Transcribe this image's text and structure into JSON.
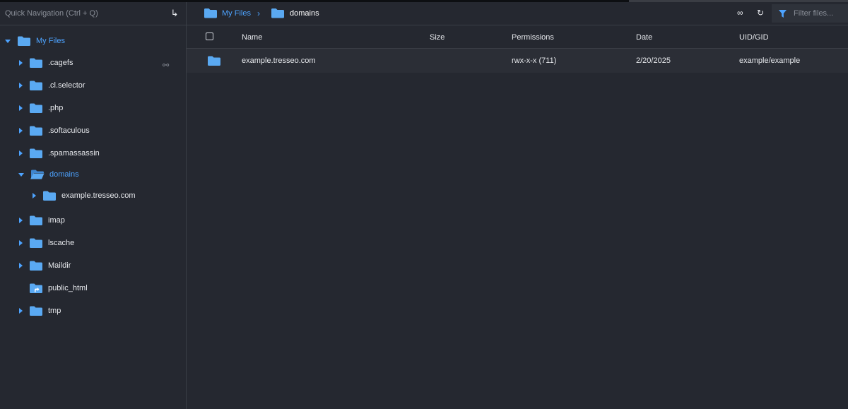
{
  "quicknav": {
    "placeholder": "Quick Navigation (Ctrl + Q)"
  },
  "tree": {
    "root": "My Files",
    "items": [
      {
        "label": ".cagefs"
      },
      {
        "label": ".cl.selector"
      },
      {
        "label": ".php"
      },
      {
        "label": ".softaculous"
      },
      {
        "label": ".spamassassin"
      },
      {
        "label": "domains"
      },
      {
        "label": "example.tresseo.com"
      },
      {
        "label": "imap"
      },
      {
        "label": "lscache"
      },
      {
        "label": "Maildir"
      },
      {
        "label": "public_html"
      },
      {
        "label": "tmp"
      }
    ]
  },
  "breadcrumb": {
    "root": "My Files",
    "current": "domains"
  },
  "filter": {
    "placeholder": "Filter files..."
  },
  "table": {
    "columns": {
      "name": "Name",
      "size": "Size",
      "permissions": "Permissions",
      "date": "Date",
      "uid": "UID/GID"
    },
    "rows": [
      {
        "name": "example.tresseo.com",
        "size": "",
        "permissions": "rwx-x-x (711)",
        "date": "2/20/2025",
        "uid": "example/example"
      }
    ]
  },
  "colors": {
    "accent": "#4da3ff",
    "folder": "#5aa9f2",
    "background": "#252830"
  }
}
